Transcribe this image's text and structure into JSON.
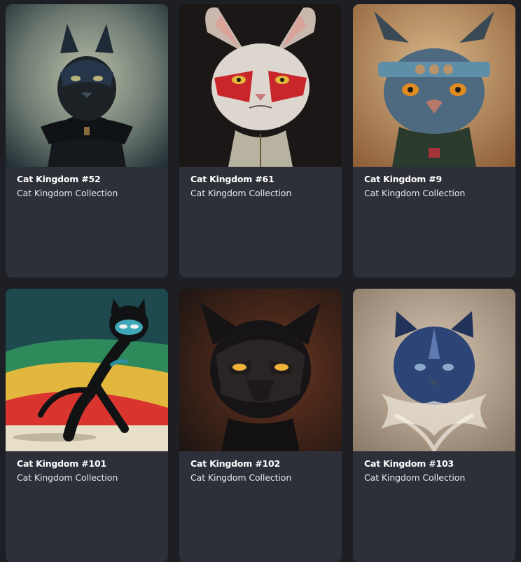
{
  "nft_cards": [
    {
      "title": "Cat Kingdom #52",
      "collection": "Cat Kingdom Collection",
      "image": "batman-cat-art"
    },
    {
      "title": "Cat Kingdom #61",
      "collection": "Cat Kingdom Collection",
      "image": "warpaint-cat-art"
    },
    {
      "title": "Cat Kingdom #9",
      "collection": "Cat Kingdom Collection",
      "image": "samurai-cat-art"
    },
    {
      "title": "Cat Kingdom #101",
      "collection": "Cat Kingdom Collection",
      "image": "masked-dancing-cat-art"
    },
    {
      "title": "Cat Kingdom #102",
      "collection": "Cat Kingdom Collection",
      "image": "armored-black-cat-art"
    },
    {
      "title": "Cat Kingdom #103",
      "collection": "Cat Kingdom Collection",
      "image": "blue-helmet-cat-art"
    }
  ],
  "colors": {
    "page_background": "#1d1f24",
    "card_background": "#2e3039",
    "title_text": "#ffffff",
    "subtitle_text": "#e6e7ea"
  }
}
